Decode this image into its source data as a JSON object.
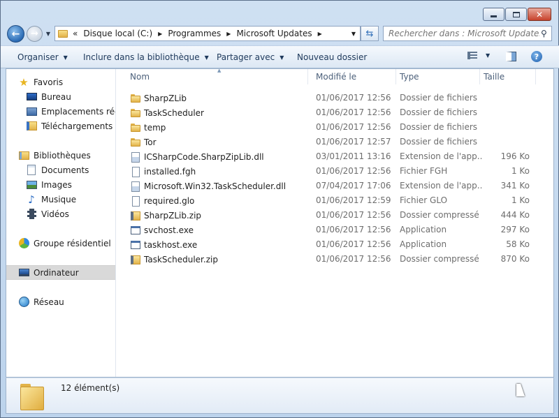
{
  "window": {
    "minimize_icon": "minimize-icon",
    "maximize_icon": "maximize-icon",
    "close_icon": "close-icon"
  },
  "address": {
    "overflow": "«",
    "crumbs": [
      "Disque local (C:)",
      "Programmes",
      "Microsoft Updates"
    ]
  },
  "search": {
    "placeholder": "Rechercher dans : Microsoft Updates"
  },
  "toolbar": {
    "organize": "Organiser",
    "include": "Inclure dans la bibliothèque",
    "share": "Partager avec",
    "new_folder": "Nouveau dossier"
  },
  "nav": {
    "favorites": "Favoris",
    "desktop": "Bureau",
    "recent": "Emplacements récents",
    "downloads": "Téléchargements",
    "libraries": "Bibliothèques",
    "documents": "Documents",
    "images": "Images",
    "music": "Musique",
    "videos": "Vidéos",
    "homegroup": "Groupe résidentiel",
    "computer": "Ordinateur",
    "network": "Réseau"
  },
  "columns": {
    "name": "Nom",
    "date": "Modifié le",
    "type": "Type",
    "size": "Taille"
  },
  "files": [
    {
      "name": "SharpZLib",
      "date": "01/06/2017 12:56",
      "type": "Dossier de fichiers",
      "size": "",
      "icon": "folder-icon"
    },
    {
      "name": "TaskScheduler",
      "date": "01/06/2017 12:56",
      "type": "Dossier de fichiers",
      "size": "",
      "icon": "folder-icon"
    },
    {
      "name": "temp",
      "date": "01/06/2017 12:56",
      "type": "Dossier de fichiers",
      "size": "",
      "icon": "folder-icon"
    },
    {
      "name": "Tor",
      "date": "01/06/2017 12:57",
      "type": "Dossier de fichiers",
      "size": "",
      "icon": "folder-icon"
    },
    {
      "name": "ICSharpCode.SharpZipLib.dll",
      "date": "03/01/2011 13:16",
      "type": "Extension de l'app...",
      "size": "196 Ko",
      "icon": "dll-icon"
    },
    {
      "name": "installed.fgh",
      "date": "01/06/2017 12:56",
      "type": "Fichier FGH",
      "size": "1 Ko",
      "icon": "file-icon"
    },
    {
      "name": "Microsoft.Win32.TaskScheduler.dll",
      "date": "07/04/2017 17:06",
      "type": "Extension de l'app...",
      "size": "341 Ko",
      "icon": "dll-icon"
    },
    {
      "name": "required.glo",
      "date": "01/06/2017 12:59",
      "type": "Fichier GLO",
      "size": "1 Ko",
      "icon": "file-icon"
    },
    {
      "name": "SharpZLib.zip",
      "date": "01/06/2017 12:56",
      "type": "Dossier compressé",
      "size": "444 Ko",
      "icon": "zip-icon"
    },
    {
      "name": "svchost.exe",
      "date": "01/06/2017 12:56",
      "type": "Application",
      "size": "297 Ko",
      "icon": "exe-icon"
    },
    {
      "name": "taskhost.exe",
      "date": "01/06/2017 12:56",
      "type": "Application",
      "size": "58 Ko",
      "icon": "exe-icon"
    },
    {
      "name": "TaskScheduler.zip",
      "date": "01/06/2017 12:56",
      "type": "Dossier compressé",
      "size": "870 Ko",
      "icon": "zip-icon"
    }
  ],
  "status": {
    "count": "12 élément(s)"
  }
}
